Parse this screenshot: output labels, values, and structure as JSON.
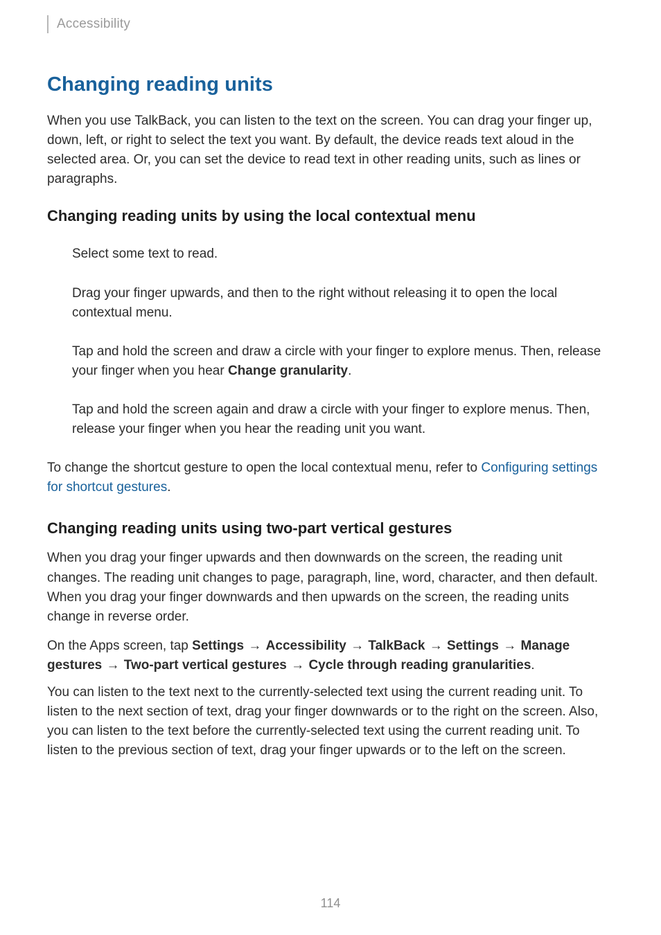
{
  "header": {
    "label": "Accessibility"
  },
  "main": {
    "title": "Changing reading units",
    "intro": "When you use TalkBack, you can listen to the text on the screen. You can drag your finger up, down, left, or right to select the text you want. By default, the device reads text aloud in the selected area. Or, you can set the device to read text in other reading units, such as lines or paragraphs.",
    "sub1": {
      "heading": "Changing reading units by using the local contextual menu",
      "steps": {
        "s1": "Select some text to read.",
        "s2": "Drag your finger upwards, and then to the right without releasing it to open the local contextual menu.",
        "s3_a": "Tap and hold the screen and draw a circle with your finger to explore menus. Then, release your finger when you hear ",
        "s3_b": "Change granularity",
        "s3_c": ".",
        "s4": "Tap and hold the screen again and draw a circle with your finger to explore menus. Then, release your finger when you hear the reading unit you want."
      },
      "footer_a": "To change the shortcut gesture to open the local contextual menu, refer to ",
      "footer_link": "Configuring settings for shortcut gestures",
      "footer_b": "."
    },
    "sub2": {
      "heading": "Changing reading units using two-part vertical gestures",
      "p1": "When you drag your finger upwards and then downwards on the screen, the reading unit changes. The reading unit changes to page, paragraph, line, word, character, and then default. When you drag your finger downwards and then upwards on the screen, the reading units change in reverse order.",
      "path": {
        "lead": "On the Apps screen, tap ",
        "seg1": "Settings",
        "seg2": "Accessibility",
        "seg3": "TalkBack",
        "seg4": "Settings",
        "seg5": "Manage gestures",
        "seg6": "Two-part vertical gestures",
        "seg7": "Cycle through reading granularities",
        "tail": "."
      },
      "p2": "You can listen to the text next to the currently-selected text using the current reading unit. To listen to the next section of text, drag your finger downwards or to the right on the screen. Also, you can listen to the text before the currently-selected text using the current reading unit. To listen to the previous section of text, drag your finger upwards or to the left on the screen."
    }
  },
  "page_number": "114",
  "glyphs": {
    "arrow": "→"
  }
}
